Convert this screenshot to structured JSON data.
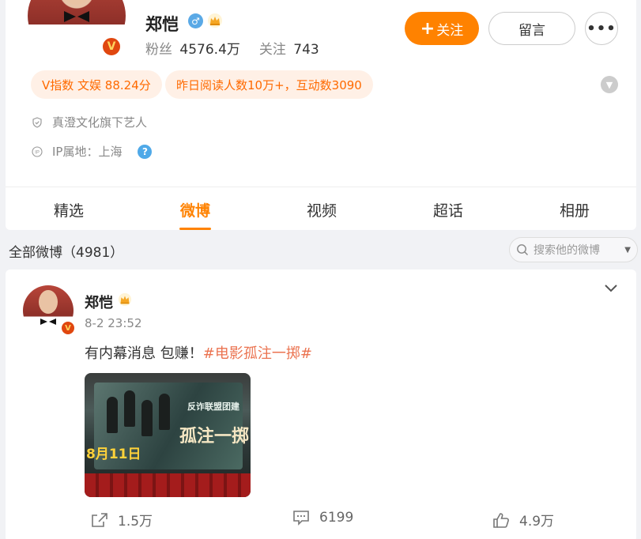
{
  "profile": {
    "name": "郑恺",
    "gender_symbol": "♂",
    "verified_mark": "V",
    "fans_label": "粉丝",
    "fans_value": "4576.4万",
    "following_label": "关注",
    "following_value": "743",
    "follow_button": "关注",
    "follow_plus": "+",
    "message_button": "留言",
    "more_button": "•••",
    "pills": [
      "V指数 文娱 88.24分",
      "昨日阅读人数10万+，互动数3090"
    ],
    "agency": "真澄文化旗下艺人",
    "ip_location": "IP属地：上海",
    "help_icon_text": "?"
  },
  "tabs": [
    {
      "label": "精选",
      "active": false
    },
    {
      "label": "微博",
      "active": true
    },
    {
      "label": "视频",
      "active": false
    },
    {
      "label": "超话",
      "active": false
    },
    {
      "label": "相册",
      "active": false
    }
  ],
  "feed": {
    "title": "全部微博（4981）",
    "search_placeholder": "搜索他的微博"
  },
  "post": {
    "author": "郑恺",
    "time": "8-2 23:52",
    "text": "有内幕消息 包赚！",
    "topic": "#电影孤注一掷#",
    "image_title": "反诈联盟团建",
    "image_big_text": "孤注一掷",
    "image_date": "8月11日",
    "shares": "1.5万",
    "comments": "6199",
    "likes": "4.9万"
  },
  "colors": {
    "accent": "#ff8200",
    "topic": "#eb7350",
    "pill_bg": "#fff0e6",
    "background": "#f1f2f5"
  }
}
